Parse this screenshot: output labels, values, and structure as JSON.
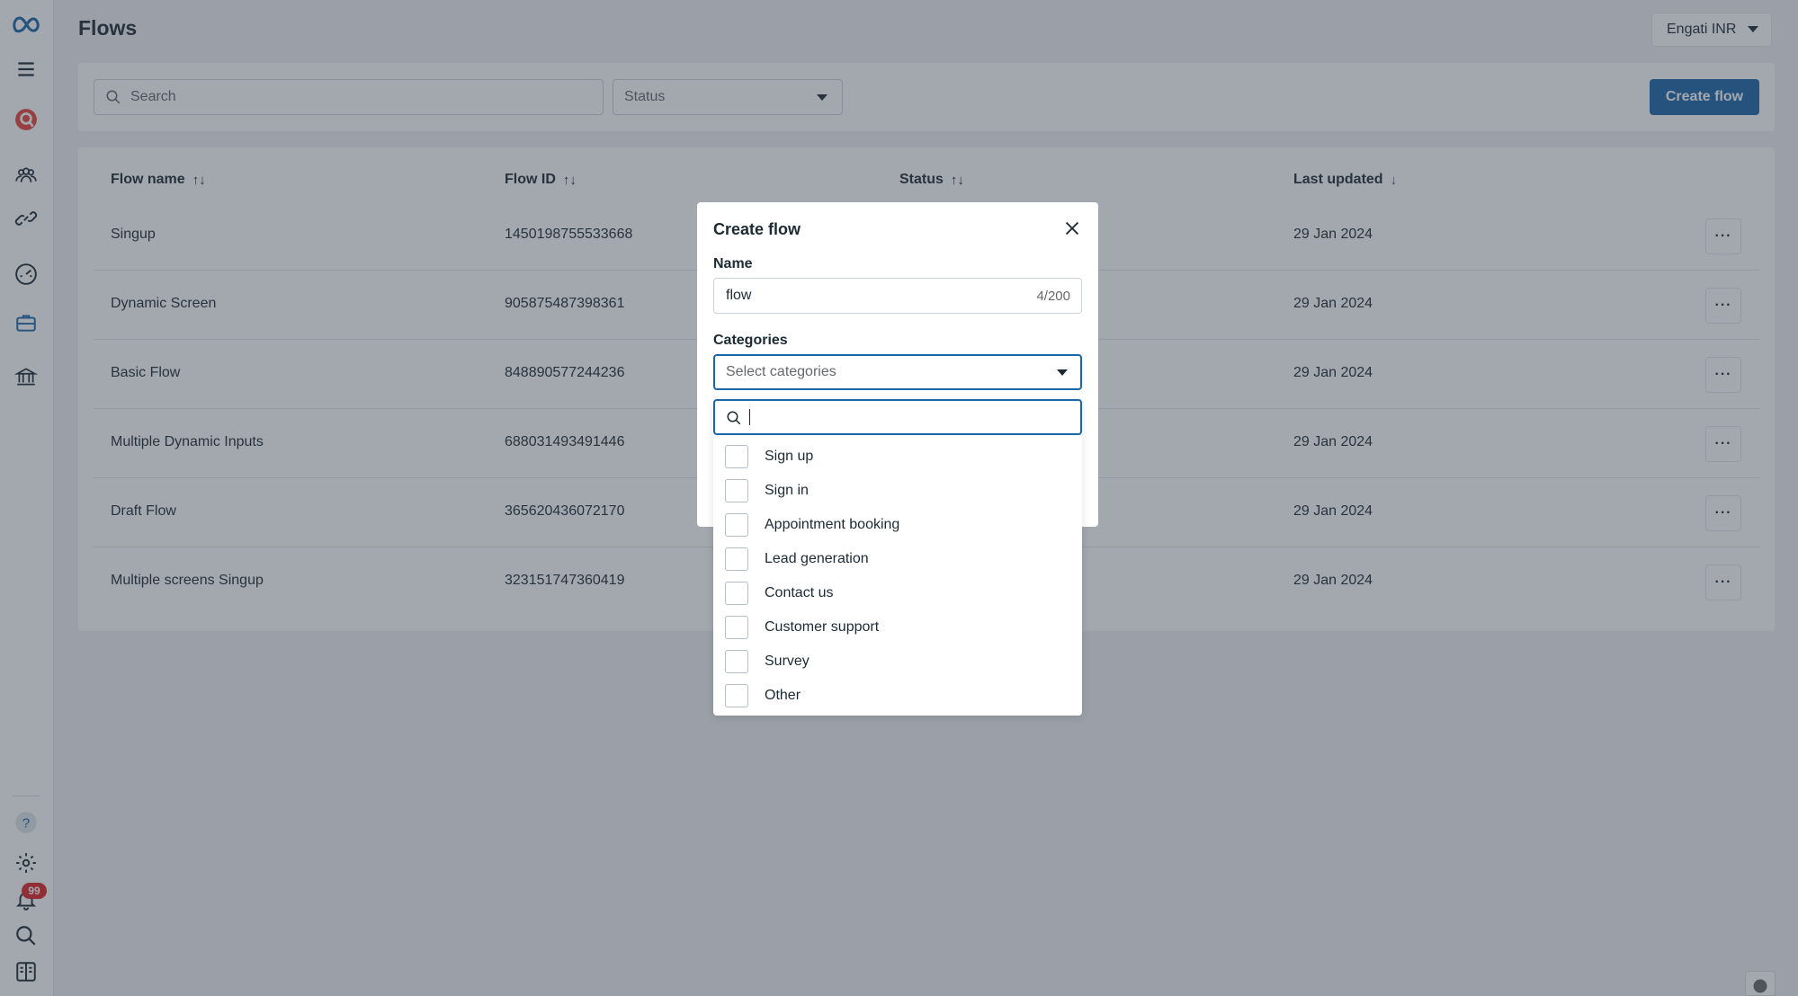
{
  "page": {
    "title": "Flows"
  },
  "account": {
    "label": "Engati INR"
  },
  "toolbar": {
    "search_placeholder": "Search",
    "status_placeholder": "Status",
    "create_label": "Create flow"
  },
  "table": {
    "headers": {
      "flow_name": "Flow name",
      "flow_id": "Flow ID",
      "status": "Status",
      "last_updated": "Last updated"
    },
    "sort_both": "↑↓",
    "sort_down": "↓",
    "more_label": "···",
    "rows": [
      {
        "name": "Singup",
        "id": "1450198755533668",
        "updated": "29 Jan 2024"
      },
      {
        "name": "Dynamic Screen",
        "id": "905875487398361",
        "updated": "29 Jan 2024"
      },
      {
        "name": "Basic Flow",
        "id": "848890577244236",
        "updated": "29 Jan 2024"
      },
      {
        "name": "Multiple Dynamic Inputs",
        "id": "688031493491446",
        "updated": "29 Jan 2024"
      },
      {
        "name": "Draft Flow",
        "id": "365620436072170",
        "updated": "29 Jan 2024"
      },
      {
        "name": "Multiple screens Singup",
        "id": "323151747360419",
        "updated": "29 Jan 2024"
      }
    ]
  },
  "modal": {
    "title": "Create flow",
    "name_label": "Name",
    "name_value": "flow",
    "name_counter": "4/200",
    "categories_label": "Categories",
    "categories_placeholder": "Select categories"
  },
  "dropdown": {
    "options": [
      "Sign up",
      "Sign in",
      "Appointment booking",
      "Lead generation",
      "Contact us",
      "Customer support",
      "Survey",
      "Other"
    ]
  },
  "notifications": {
    "count": "99"
  },
  "colors": {
    "primary": "#1a67a8",
    "badge": "#e02424",
    "text": "#1c2b33",
    "overlay": "rgba(50,60,75,0.45)"
  }
}
